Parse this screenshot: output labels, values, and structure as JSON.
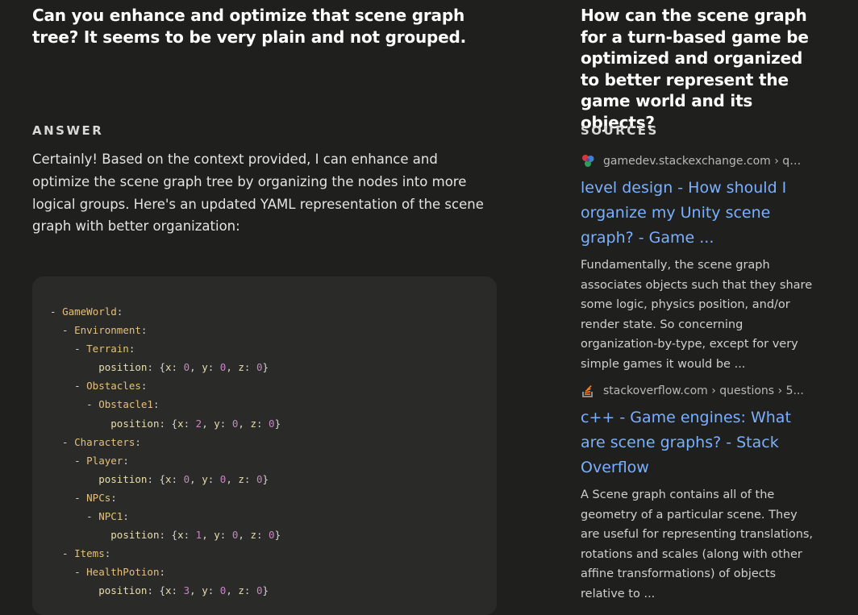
{
  "left": {
    "question": "Can you enhance and optimize that scene graph tree? It seems to be very plain and not grouped.",
    "answer_label": "ANSWER",
    "answer_text": "Certainly! Based on the context provided, I can enhance and optimize the scene graph tree by organizing the nodes into more logical groups. Here's an updated YAML representation of the scene graph with better organization:"
  },
  "code_lines": [
    [
      [
        "- ",
        "p"
      ],
      [
        "GameWorld",
        "name"
      ],
      [
        ":",
        "p"
      ]
    ],
    [
      [
        "  - ",
        "p"
      ],
      [
        "Environment",
        "name"
      ],
      [
        ":",
        "p"
      ]
    ],
    [
      [
        "    - ",
        "p"
      ],
      [
        "Terrain",
        "name"
      ],
      [
        ":",
        "p"
      ]
    ],
    [
      [
        "        ",
        "p"
      ],
      [
        "position",
        "prop"
      ],
      [
        ": {",
        "p"
      ],
      [
        "x",
        "prop"
      ],
      [
        ": ",
        "p"
      ],
      [
        "0",
        "num"
      ],
      [
        ", ",
        "p"
      ],
      [
        "y",
        "prop"
      ],
      [
        ": ",
        "p"
      ],
      [
        "0",
        "num"
      ],
      [
        ", ",
        "p"
      ],
      [
        "z",
        "prop"
      ],
      [
        ": ",
        "p"
      ],
      [
        "0",
        "num"
      ],
      [
        "}",
        "p"
      ]
    ],
    [
      [
        "    - ",
        "p"
      ],
      [
        "Obstacles",
        "name"
      ],
      [
        ":",
        "p"
      ]
    ],
    [
      [
        "      - ",
        "p"
      ],
      [
        "Obstacle1",
        "name"
      ],
      [
        ":",
        "p"
      ]
    ],
    [
      [
        "          ",
        "p"
      ],
      [
        "position",
        "prop"
      ],
      [
        ": {",
        "p"
      ],
      [
        "x",
        "prop"
      ],
      [
        ": ",
        "p"
      ],
      [
        "2",
        "num"
      ],
      [
        ", ",
        "p"
      ],
      [
        "y",
        "prop"
      ],
      [
        ": ",
        "p"
      ],
      [
        "0",
        "num"
      ],
      [
        ", ",
        "p"
      ],
      [
        "z",
        "prop"
      ],
      [
        ": ",
        "p"
      ],
      [
        "0",
        "num"
      ],
      [
        "}",
        "p"
      ]
    ],
    [
      [
        "  - ",
        "p"
      ],
      [
        "Characters",
        "name"
      ],
      [
        ":",
        "p"
      ]
    ],
    [
      [
        "    - ",
        "p"
      ],
      [
        "Player",
        "name"
      ],
      [
        ":",
        "p"
      ]
    ],
    [
      [
        "        ",
        "p"
      ],
      [
        "position",
        "prop"
      ],
      [
        ": {",
        "p"
      ],
      [
        "x",
        "prop"
      ],
      [
        ": ",
        "p"
      ],
      [
        "0",
        "num"
      ],
      [
        ", ",
        "p"
      ],
      [
        "y",
        "prop"
      ],
      [
        ": ",
        "p"
      ],
      [
        "0",
        "num"
      ],
      [
        ", ",
        "p"
      ],
      [
        "z",
        "prop"
      ],
      [
        ": ",
        "p"
      ],
      [
        "0",
        "num"
      ],
      [
        "}",
        "p"
      ]
    ],
    [
      [
        "    - ",
        "p"
      ],
      [
        "NPCs",
        "name"
      ],
      [
        ":",
        "p"
      ]
    ],
    [
      [
        "      - ",
        "p"
      ],
      [
        "NPC1",
        "name"
      ],
      [
        ":",
        "p"
      ]
    ],
    [
      [
        "          ",
        "p"
      ],
      [
        "position",
        "prop"
      ],
      [
        ": {",
        "p"
      ],
      [
        "x",
        "prop"
      ],
      [
        ": ",
        "p"
      ],
      [
        "1",
        "num"
      ],
      [
        ", ",
        "p"
      ],
      [
        "y",
        "prop"
      ],
      [
        ": ",
        "p"
      ],
      [
        "0",
        "num"
      ],
      [
        ", ",
        "p"
      ],
      [
        "z",
        "prop"
      ],
      [
        ": ",
        "p"
      ],
      [
        "0",
        "num"
      ],
      [
        "}",
        "p"
      ]
    ],
    [
      [
        "  - ",
        "p"
      ],
      [
        "Items",
        "name"
      ],
      [
        ":",
        "p"
      ]
    ],
    [
      [
        "    - ",
        "p"
      ],
      [
        "HealthPotion",
        "name"
      ],
      [
        ":",
        "p"
      ]
    ],
    [
      [
        "        ",
        "p"
      ],
      [
        "position",
        "prop"
      ],
      [
        ": {",
        "p"
      ],
      [
        "x",
        "prop"
      ],
      [
        ": ",
        "p"
      ],
      [
        "3",
        "num"
      ],
      [
        ", ",
        "p"
      ],
      [
        "y",
        "prop"
      ],
      [
        ": ",
        "p"
      ],
      [
        "0",
        "num"
      ],
      [
        ", ",
        "p"
      ],
      [
        "z",
        "prop"
      ],
      [
        ": ",
        "p"
      ],
      [
        "0",
        "num"
      ],
      [
        "}",
        "p"
      ]
    ]
  ],
  "right": {
    "question": "How can the scene graph for a turn-based game be optimized and organized to better represent the game world and its objects?",
    "sources_label": "SOURCES",
    "sources": [
      {
        "favicon": "gamedev-stackexchange-icon",
        "domain": "gamedev.stackexchange.com › qu...",
        "title": "level design - How should I organize my Unity scene graph? - Game ...",
        "snippet": "Fundamentally, the scene graph associates objects such that they share some logic, physics position, and/or render state. So concerning organization-by-type, except for very simple games it would be ..."
      },
      {
        "favicon": "stackoverflow-icon",
        "domain": "stackoverflow.com › questions › 5...",
        "title": "c++ - Game engines: What are scene graphs? - Stack Overflow",
        "snippet": "A Scene graph contains all of the geometry of a particular scene. They are useful for representing translations, rotations and scales (along with other affine transformations) of objects relative to ..."
      }
    ]
  },
  "colors": {
    "background": "#1f1f1d",
    "code_background": "#2a2a28",
    "link": "#7ab0ff",
    "code_name": "#e5c07b",
    "code_number": "#c586c0"
  }
}
